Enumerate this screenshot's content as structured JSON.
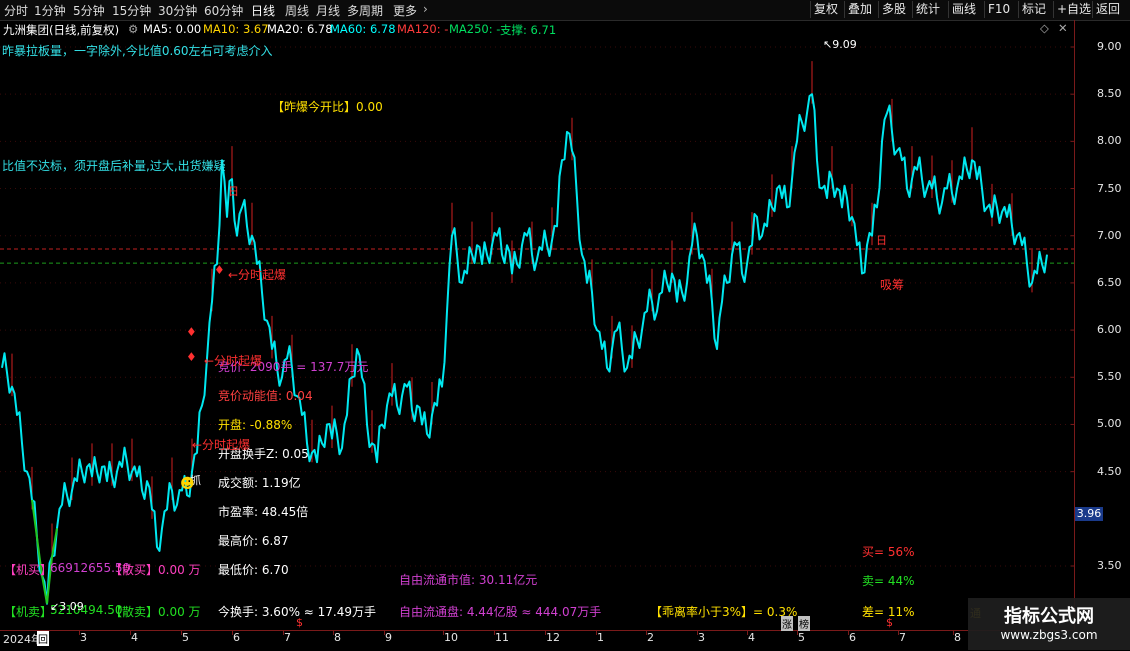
{
  "topbar": {
    "periods": [
      "分时",
      "1分钟",
      "5分钟",
      "15分钟",
      "30分钟",
      "60分钟",
      "日线",
      "周线",
      "月线",
      "多周期",
      "更多"
    ],
    "active_period": "日线",
    "right_buttons": [
      "复权",
      "叠加",
      "多股",
      "统计",
      "画线",
      "F10",
      "标记",
      "+自选",
      "返回"
    ]
  },
  "infobar": {
    "stock_title": "九洲集团(日线,前复权)",
    "ma5": "MA5: 0.00",
    "ma10": "MA10: 3.67",
    "ma20": "MA20: 6.78",
    "ma60": "MA60: 6.78",
    "ma120": "MA120: -",
    "ma250": "MA250: -",
    "support": "支撑: 6.71",
    "colors": {
      "ma5": "#ffffff",
      "ma10": "#ffd400",
      "ma20": "#ffffff",
      "ma60": "#00ffff",
      "ma120": "#ff3b3b",
      "ma250": "#00e060",
      "support": "#00e060"
    }
  },
  "chart_data": {
    "type": "line",
    "series_color": "#00e8f0",
    "ylim": [
      3.3,
      9.3
    ],
    "y_ticks": [
      "9.00",
      "8.50",
      "8.00",
      "7.50",
      "7.00",
      "6.50",
      "6.00",
      "5.50",
      "5.00",
      "4.50",
      "3.50"
    ],
    "current_price_label": "3.96",
    "x_tick_labels": [
      "2024年",
      "3",
      "4",
      "5",
      "6",
      "7",
      "8",
      "9",
      "10",
      "11",
      "12",
      "1",
      "2",
      "3",
      "4",
      "5",
      "6",
      "7",
      "8"
    ],
    "annotations": {
      "peak": "9.09",
      "trough": "3.09"
    },
    "x": [
      0,
      5,
      10,
      15,
      20,
      25,
      30,
      35,
      40,
      45,
      50,
      55,
      60,
      65,
      70,
      75,
      80,
      85,
      90,
      95,
      100,
      105,
      110,
      115,
      120,
      125,
      130,
      135,
      140,
      145,
      150,
      155,
      160,
      165,
      170,
      175,
      180,
      185,
      190,
      195,
      200,
      205,
      210,
      215,
      220,
      225,
      230,
      235,
      240,
      245,
      250,
      255,
      260,
      265,
      270,
      275,
      280,
      285,
      290,
      295,
      300,
      305,
      310,
      315,
      320,
      325,
      330,
      335,
      340,
      345,
      350,
      355,
      360,
      365,
      370,
      375,
      380,
      385,
      390,
      395,
      400,
      405,
      410,
      415,
      420,
      425,
      430,
      435,
      440,
      445,
      450,
      455,
      460,
      465,
      470,
      475,
      480,
      485,
      490,
      495,
      500,
      505,
      510,
      515,
      520,
      525,
      530,
      535,
      540,
      545,
      550,
      555,
      560,
      565,
      570,
      575,
      580,
      585,
      590,
      595,
      600,
      605,
      610,
      615,
      620,
      625,
      630,
      635,
      640,
      645,
      650,
      655,
      660,
      665,
      670,
      675,
      680,
      685,
      690,
      695,
      700,
      705,
      710,
      715,
      720,
      725,
      730,
      735,
      740,
      745,
      750,
      755,
      760,
      765,
      770,
      775,
      780,
      785,
      790,
      795,
      800,
      805,
      810,
      815,
      820,
      825,
      830,
      835,
      840,
      845,
      850,
      855,
      860,
      865,
      870,
      875,
      880,
      885,
      890,
      895,
      900,
      905,
      910,
      915,
      920,
      925,
      930,
      935,
      940,
      945,
      950,
      955,
      960,
      965,
      970,
      975,
      980,
      985,
      990,
      995,
      1000,
      1005,
      1010,
      1015,
      1020,
      1025,
      1030,
      1035,
      1040,
      1045,
      1050,
      1055,
      1060,
      1065
    ],
    "y": [
      5.6,
      5.55,
      5.4,
      5.1,
      4.8,
      4.5,
      4.2,
      3.8,
      3.4,
      3.1,
      3.6,
      3.9,
      4.15,
      4.25,
      4.3,
      4.4,
      4.5,
      4.55,
      4.45,
      4.5,
      4.55,
      4.4,
      4.45,
      4.5,
      4.55,
      4.6,
      4.5,
      4.45,
      4.3,
      4.4,
      4.1,
      3.7,
      3.9,
      4.1,
      4.3,
      4.15,
      4.3,
      4.25,
      4.5,
      4.7,
      5.2,
      5.7,
      6.3,
      6.7,
      7.8,
      7.2,
      7.6,
      7.0,
      7.3,
      7.1,
      7.0,
      6.7,
      6.4,
      6.1,
      5.8,
      5.6,
      5.5,
      5.7,
      5.6,
      5.3,
      5.1,
      4.8,
      4.7,
      4.6,
      4.8,
      5.0,
      4.85,
      4.9,
      4.75,
      5.1,
      5.5,
      5.8,
      5.5,
      5.0,
      4.8,
      4.6,
      5.0,
      5.2,
      5.3,
      5.2,
      5.3,
      5.4,
      5.15,
      5.2,
      5.0,
      4.9,
      5.1,
      5.2,
      5.4,
      6.2,
      7.0,
      6.8,
      6.5,
      6.6,
      6.8,
      6.9,
      6.7,
      6.8,
      6.9,
      7.0,
      6.8,
      6.9,
      6.6,
      6.7,
      6.9,
      7.0,
      6.8,
      6.75,
      6.85,
      6.9,
      6.95,
      7.1,
      7.8,
      8.1,
      7.9,
      7.4,
      6.8,
      6.5,
      6.4,
      6.0,
      5.8,
      5.6,
      5.8,
      6.0,
      5.8,
      5.6,
      5.7,
      5.9,
      6.0,
      6.2,
      6.3,
      6.2,
      6.4,
      6.5,
      6.6,
      6.3,
      6.4,
      6.5,
      6.9,
      7.0,
      6.8,
      6.5,
      6.3,
      5.8,
      6.3,
      6.5,
      6.8,
      6.9,
      6.6,
      6.7,
      6.9,
      7.2,
      7.0,
      7.1,
      7.3,
      7.5,
      7.4,
      7.3,
      7.6,
      8.0,
      8.2,
      8.3,
      8.5,
      7.8,
      7.5,
      7.4,
      7.6,
      7.5,
      7.3,
      7.4,
      7.2,
      6.9,
      6.6,
      6.9,
      7.0,
      7.3,
      8.0,
      8.3,
      8.1,
      7.9,
      7.8,
      7.5,
      7.6,
      7.7,
      7.6,
      7.5,
      7.5,
      7.4,
      7.35,
      7.5,
      7.45,
      7.5,
      7.6,
      7.7,
      7.8,
      7.6,
      7.5,
      7.3,
      7.2,
      7.3,
      7.25,
      7.2,
      7.1,
      7.0,
      6.9,
      6.7,
      6.5,
      6.6,
      6.7,
      6.8
    ]
  },
  "overlay_text": {
    "warn1": "昨暴拉板量，一字除外,今比值0.60左右可考虑介入",
    "warn2": "比值不达标，须开盘后补量,过大,出货嫌疑",
    "yesterday_open": "【昨爆今开比】0.00",
    "bid_price": "竞价: 2090手 = 137.7万元",
    "bid_energy": "竞价动能值: 0.04",
    "open": "开盘: -0.88%",
    "open_turnover": "开盘换手Z: 0.05",
    "amount": "成交额: 1.19亿",
    "pe": "市盈率: 48.45倍",
    "high": "最高价: 6.87",
    "low": "最低价: 6.70",
    "turnover": "今换手: 3.60% ≈ 17.49万手",
    "float_mv": "自由流通市值: 30.11亿元",
    "float_share": "自由流通盘: 4.44亿股 ≈ 444.07万手",
    "deviation": "【乖离率小于3%】= 0.3%",
    "inst_buy_label": "【机买】",
    "inst_buy_val": "66912655.50",
    "scatter_buy_label": "【散买】",
    "scatter_buy_val": "0.00 万",
    "inst_sell_label": "【机卖】",
    "inst_sell_val": "5210494.50",
    "scatter_sell_label": "【散卖】",
    "scatter_sell_val": "0.00 万",
    "buy_pct": "买= 56%",
    "sell_pct": "卖= 44%",
    "diff_pct": "差= 11%",
    "signal_fenshi1": "←分时起爆",
    "signal_fenshi2": "←分时起爆",
    "signal_fenshi3": "←分时起爆",
    "signal_xichou": "吸筹",
    "signal_zhua": "抓",
    "mark_tong": "通",
    "mark_zhang": "涨",
    "mark_bang": "榜",
    "mark_dollar": "$",
    "mark_hui": "回"
  },
  "watermark": {
    "line1": "指标公式网",
    "line2": "www.zbgs3.com"
  }
}
